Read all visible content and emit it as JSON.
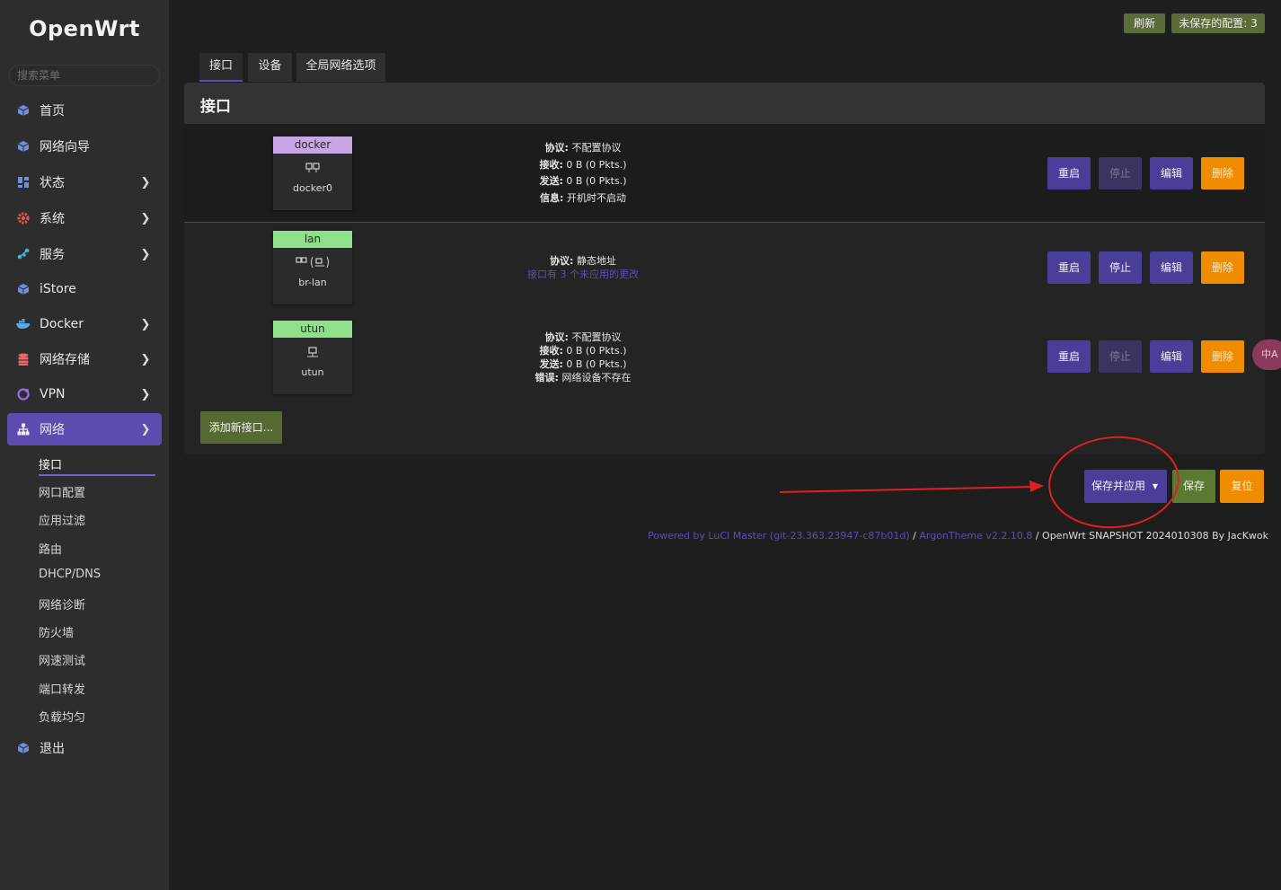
{
  "app": {
    "logo": "OpenWrt"
  },
  "sidebar": {
    "search_placeholder": "搜索菜单",
    "items": [
      {
        "label": "首页",
        "icon": "cube-icon"
      },
      {
        "label": "网络向导",
        "icon": "cube-icon"
      },
      {
        "label": "状态",
        "icon": "dashboard-icon"
      },
      {
        "label": "系统",
        "icon": "gear-icon"
      },
      {
        "label": "服务",
        "icon": "share-icon"
      },
      {
        "label": "iStore",
        "icon": "cube-icon"
      },
      {
        "label": "Docker",
        "icon": "docker-icon"
      },
      {
        "label": "网络存储",
        "icon": "storage-icon"
      },
      {
        "label": "VPN",
        "icon": "vpn-icon"
      },
      {
        "label": "网络",
        "icon": "network-icon"
      },
      {
        "label": "退出",
        "icon": "cube-icon"
      }
    ],
    "sub_items": [
      "接口",
      "网口配置",
      "应用过滤",
      "路由",
      "DHCP/DNS",
      "网络诊断",
      "防火墙",
      "网速测试",
      "端口转发",
      "负载均匀"
    ]
  },
  "top": {
    "refresh_label": "刷新",
    "unsaved_label": "未保存的配置: 3"
  },
  "tabs": [
    "接口",
    "设备",
    "全局网络选项"
  ],
  "panel": {
    "title": "接口"
  },
  "interfaces": [
    {
      "name": "docker",
      "device": "docker0",
      "color": "#c9a6e6",
      "info": [
        {
          "k": "协议:",
          "v": " 不配置协议"
        },
        {
          "k": "接收:",
          "v": " 0 B (0 Pkts.)"
        },
        {
          "k": "发送:",
          "v": " 0 B (0 Pkts.)"
        },
        {
          "k": "信息:",
          "v": " 开机时不启动"
        }
      ]
    },
    {
      "name": "lan",
      "device": "br-lan",
      "color": "#8ee08a",
      "info": [
        {
          "k": "协议:",
          "v": " 静态地址"
        }
      ],
      "pending": "接口有 3 个未应用的更改"
    },
    {
      "name": "utun",
      "device": "utun",
      "color": "#8ee08a",
      "info": [
        {
          "k": "协议:",
          "v": " 不配置协议"
        },
        {
          "k": "接收:",
          "v": " 0 B (0 Pkts.)"
        },
        {
          "k": "发送:",
          "v": " 0 B (0 Pkts.)"
        },
        {
          "k": "错误:",
          "v": " 网络设备不存在"
        }
      ]
    }
  ],
  "actions": {
    "restart": "重启",
    "stop": "停止",
    "edit": "编辑",
    "delete": "删除"
  },
  "add_interface_label": "添加新接口...",
  "bottom": {
    "save_apply": "保存并应用",
    "save": "保存",
    "reset": "复位"
  },
  "footer": {
    "luci": "Powered by LuCI Master (git-23.363.23947-c87b01d)",
    "sep1": " / ",
    "theme": "ArgonTheme v2.2.10.8",
    "sep2": " / ",
    "build": "OpenWrt SNAPSHOT 2024010308 By JacKwok"
  },
  "lang_toggle": "中A",
  "colors": {
    "accent": "#5e4bb0",
    "warning": "#f08c00",
    "success": "#5a7a32",
    "annotation": "#e02020"
  }
}
